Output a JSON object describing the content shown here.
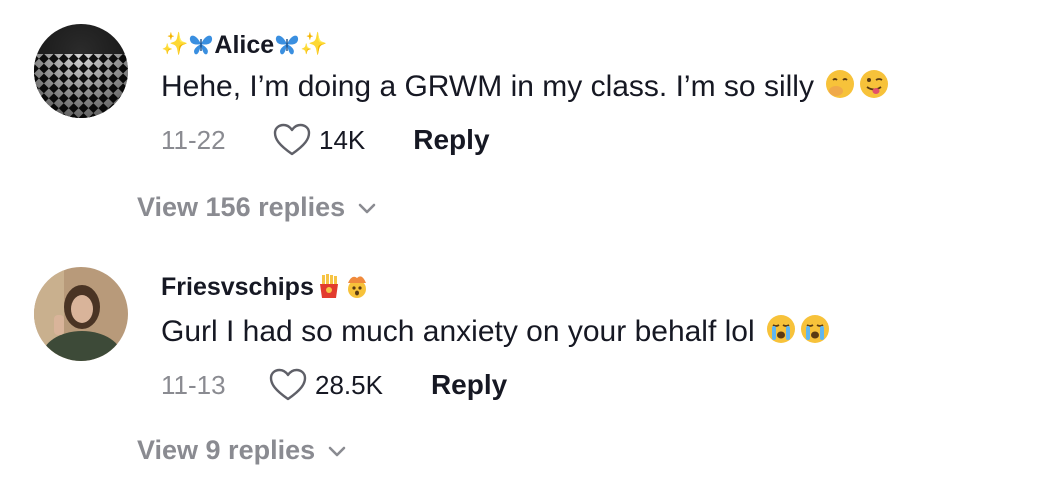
{
  "comments": [
    {
      "username": "Alice",
      "text": "Hehe, I’m doing a GRWM in my class. I’m so silly",
      "date": "11-22",
      "likes": "14K",
      "reply_label": "Reply",
      "view_replies": "View 156 replies",
      "username_icons": [
        "sparkles-icon",
        "butterfly-icon"
      ],
      "text_emojis": [
        "face-with-hand-over-mouth-emoji",
        "winking-face-with-tongue-emoji"
      ]
    },
    {
      "username": "Friesvschips",
      "text": "Gurl I had so much anxiety on your behalf lol",
      "date": "11-13",
      "likes": "28.5K",
      "reply_label": "Reply",
      "view_replies": "View 9 replies",
      "username_icons": [
        "french-fries-icon",
        "exploding-head-icon"
      ],
      "text_emojis": [
        "loudly-crying-face-emoji",
        "loudly-crying-face-emoji"
      ]
    }
  ],
  "colors": {
    "text_primary": "#161823",
    "text_secondary": "#8a8b91",
    "emoji_yellow": "#f7c23a",
    "butterfly_blue": "#3a8fe0"
  }
}
